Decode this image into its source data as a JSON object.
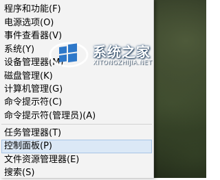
{
  "menu": {
    "items": [
      {
        "label": "程序和功能(F)"
      },
      {
        "label": "电源选项(O)"
      },
      {
        "label": "事件查看器(V)"
      },
      {
        "label": "系统(Y)"
      },
      {
        "label": "设备管理器(M)"
      },
      {
        "label": "磁盘管理(K)"
      },
      {
        "label": "计算机管理(G)"
      },
      {
        "label": "命令提示符(C)"
      },
      {
        "label": "命令提示符(管理员)(A)"
      },
      {
        "label": "任务管理器(T)"
      },
      {
        "label": "控制面板(P)",
        "selected": true
      },
      {
        "label": "文件资源管理器(E)"
      },
      {
        "label": "搜索(S)"
      }
    ],
    "selected_color": "#dbe8f6",
    "selected_border_color": "#a6c4e6"
  },
  "watermark": {
    "text": "系统之家",
    "url": "XITONGZHIJIA.NET",
    "icon": "windows-logo-icon"
  }
}
